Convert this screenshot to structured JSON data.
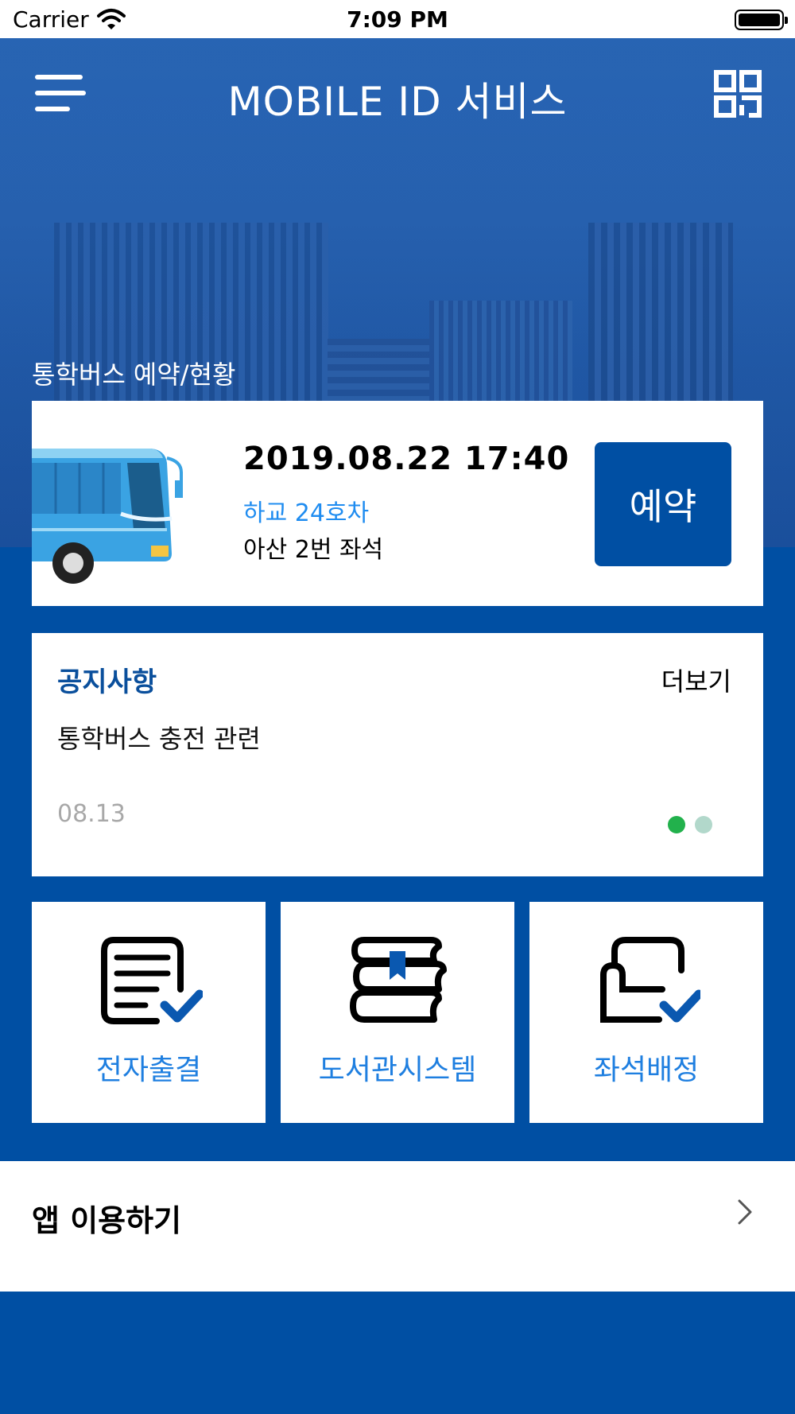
{
  "status_bar": {
    "carrier": "Carrier",
    "time": "7:09 PM"
  },
  "header": {
    "title": "MOBILE ID 서비스",
    "menu_icon": "hamburger-menu-icon",
    "qr_icon": "qr-code-icon"
  },
  "bus_reservation": {
    "section_label": "통학버스 예약/현황",
    "date_time": "2019.08.22  17:40",
    "route": "하교  24호차",
    "seat": "아산  2번 좌석",
    "reserve_button": "예약",
    "image": "bus-image"
  },
  "notice": {
    "title": "공지사항",
    "more": "더보기",
    "item_title": "통학버스 충전 관련",
    "item_date": "08.13",
    "pager": {
      "page_count": 2,
      "current_page": 1
    }
  },
  "menu_tiles": [
    {
      "label": "전자출결",
      "icon": "attendance-checklist-icon"
    },
    {
      "label": "도서관시스템",
      "icon": "library-books-icon"
    },
    {
      "label": "좌석배정",
      "icon": "seat-assignment-icon"
    }
  ],
  "app_usage": {
    "label": "앱 이용하기",
    "icon": "chevron-right-icon"
  },
  "colors": {
    "primary_blue": "#004fa3",
    "link_blue": "#1f8cf0",
    "notice_title": "#0a4f9c",
    "pager_active": "#22b14c",
    "pager_inactive": "#b2d8cb"
  }
}
